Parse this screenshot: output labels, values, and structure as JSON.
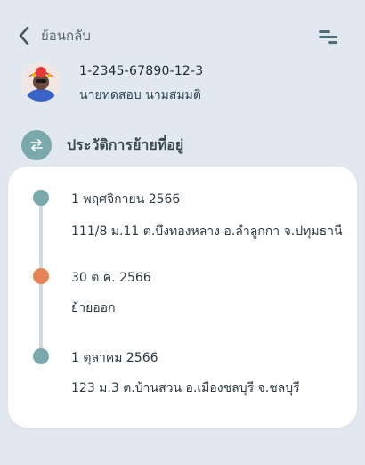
{
  "header": {
    "back_label": "ย้อนกลับ",
    "icons": {
      "back": "chevron-left-icon",
      "menu": "menu-lines-icon"
    }
  },
  "profile": {
    "id_number": "1-2345-67890-12-3",
    "name": "นายทดสอบ  นามสมมติ"
  },
  "section": {
    "title": "ประวัติการย้ายที่อยู่",
    "icon": "swap-arrows-icon"
  },
  "timeline": [
    {
      "date": "1 พฤศจิกายน 2566",
      "detail": "111/8 ม.11 ต.บึงทองหลาง อ.ลำลูกกา จ.ปทุมธานี",
      "status_color": "#7aa9ac"
    },
    {
      "date": "30 ต.ค. 2566",
      "detail": "ย้ายออก",
      "status_color": "#e58356"
    },
    {
      "date": "1 ตุลาคม 2566",
      "detail": "123 ม.3 ต.บ้านสวน อ.เมืองชลบุรี จ.ชลบุรี",
      "status_color": "#7aa9ac"
    }
  ],
  "colors": {
    "background": "#e2e8ef",
    "accent": "#7aa9ac",
    "move_out": "#e58356",
    "card": "#ffffff"
  }
}
